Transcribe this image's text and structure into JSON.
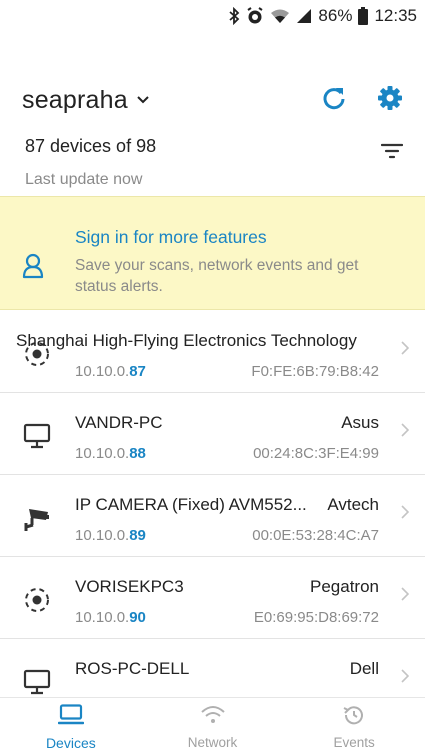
{
  "status_bar": {
    "battery": "86%",
    "time": "12:35",
    "icons": [
      "bluetooth-icon",
      "alarm-icon",
      "wifi-icon",
      "signal-icon",
      "battery-icon"
    ]
  },
  "header": {
    "network_name": "seapraha",
    "icons": [
      "chevron-down-icon",
      "refresh-icon",
      "settings-icon"
    ],
    "accent_color": "#1a85c4"
  },
  "summary": {
    "count_text": "87 devices of 98",
    "last_update": "Last update now"
  },
  "signin_banner": {
    "title": "Sign in for more features",
    "description": "Save your scans, network events and get status alerts.",
    "background_color": "#fcf8c6"
  },
  "devices": [
    {
      "name": "Shanghai High-Flying Electronics Technology",
      "vendor": "",
      "ip_prefix": "10.10.0.",
      "ip_suffix": "87",
      "mac": "F0:FE:6B:79:B8:42",
      "icon": "generic-device-icon"
    },
    {
      "name": "VANDR-PC",
      "vendor": "Asus",
      "ip_prefix": "10.10.0.",
      "ip_suffix": "88",
      "mac": "00:24:8C:3F:E4:99",
      "icon": "desktop-icon"
    },
    {
      "name": "IP CAMERA (Fixed) AVM552...",
      "vendor": "Avtech",
      "ip_prefix": "10.10.0.",
      "ip_suffix": "89",
      "mac": "00:0E:53:28:4C:A7",
      "icon": "camera-icon"
    },
    {
      "name": "VORISEKPC3",
      "vendor": "Pegatron",
      "ip_prefix": "10.10.0.",
      "ip_suffix": "90",
      "mac": "E0:69:95:D8:69:72",
      "icon": "generic-device-icon"
    },
    {
      "name": "ROS-PC-DELL",
      "vendor": "Dell",
      "ip_prefix": "",
      "ip_suffix": "",
      "mac": "",
      "icon": "desktop-icon"
    }
  ],
  "tabs": [
    {
      "label": "Devices",
      "icon": "devices-icon",
      "active": true
    },
    {
      "label": "Network",
      "icon": "wifi-icon",
      "active": false
    },
    {
      "label": "Events",
      "icon": "history-icon",
      "active": false
    }
  ]
}
